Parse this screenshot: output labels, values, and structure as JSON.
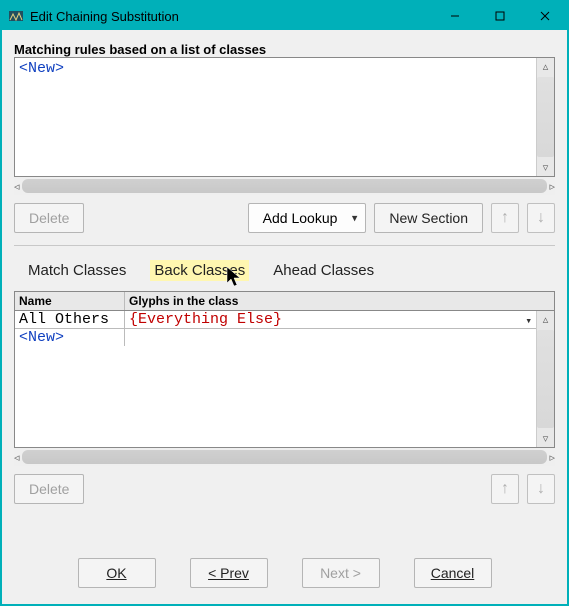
{
  "window": {
    "title": "Edit Chaining Substitution"
  },
  "rules": {
    "label": "Matching rules based on a list of classes",
    "items": [
      "<New>"
    ]
  },
  "actions": {
    "delete_top": "Delete",
    "add_lookup": "Add Lookup",
    "new_section": "New Section"
  },
  "tabs": {
    "match": "Match Classes",
    "back": "Back Classes",
    "ahead": "Ahead Classes",
    "active": "back"
  },
  "class_table": {
    "headers": {
      "name": "Name",
      "glyphs": "Glyphs in the class"
    },
    "rows": [
      {
        "name": "All Others",
        "glyphs": "{Everything Else}"
      }
    ],
    "new_placeholder": "<New>"
  },
  "actions2": {
    "delete_bottom": "Delete"
  },
  "footer": {
    "ok": "OK",
    "prev": "< Prev",
    "next": "Next >",
    "cancel": "Cancel"
  }
}
